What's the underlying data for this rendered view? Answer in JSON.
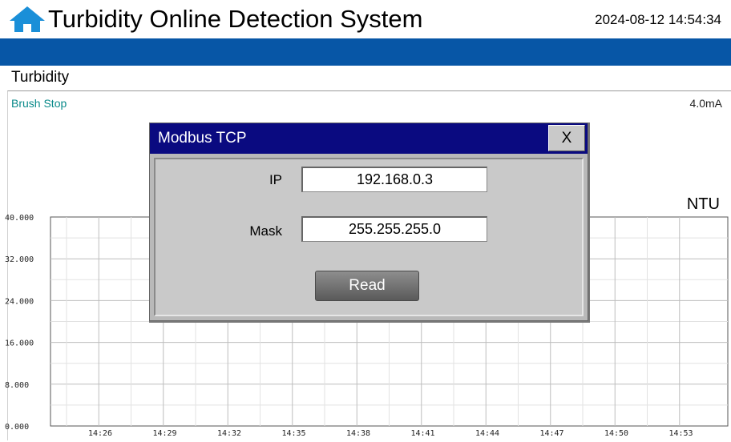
{
  "header": {
    "title": "Turbidity Online Detection System",
    "datetime": "2024-08-12 14:54:34"
  },
  "section": {
    "title": "Turbidity"
  },
  "status": {
    "brush": "Brush Stop",
    "current_output": "4.0mA"
  },
  "chart": {
    "unit": "NTU",
    "y_ticks": [
      "40.000",
      "32.000",
      "24.000",
      "16.000",
      "8.000",
      "0.000"
    ],
    "x_ticks": [
      "14:26",
      "14:29",
      "14:32",
      "14:35",
      "14:38",
      "14:41",
      "14:44",
      "14:47",
      "14:50",
      "14:53"
    ]
  },
  "chart_data": {
    "type": "line",
    "title": "",
    "xlabel": "",
    "ylabel": "NTU",
    "ylim": [
      0,
      40
    ],
    "x_tick_labels": [
      "14:26",
      "14:29",
      "14:32",
      "14:35",
      "14:38",
      "14:41",
      "14:44",
      "14:47",
      "14:50",
      "14:53"
    ],
    "y_tick_labels": [
      "40.000",
      "32.000",
      "24.000",
      "16.000",
      "8.000",
      "0.000"
    ],
    "series": [],
    "grid": true
  },
  "dialog": {
    "title": "Modbus TCP",
    "close_label": "X",
    "ip_label": "IP",
    "ip_value": "192.168.0.3",
    "mask_label": "Mask",
    "mask_value": "255.255.255.0",
    "read_label": "Read"
  },
  "colors": {
    "title_bar": "#0756a6",
    "dialog_titlebar": "#0a0a80",
    "status_text": "#0a8a8a"
  },
  "icons": {
    "home": "home-icon"
  }
}
